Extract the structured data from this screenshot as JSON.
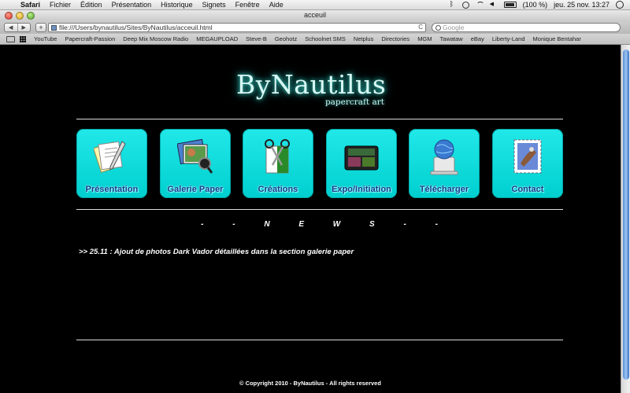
{
  "menubar": {
    "apple": "",
    "app_name": "Safari",
    "menus": [
      "Fichier",
      "Édition",
      "Présentation",
      "Historique",
      "Signets",
      "Fenêtre",
      "Aide"
    ],
    "battery": "(100 %)",
    "datetime": "jeu. 25 nov.  13:27"
  },
  "window": {
    "title": "acceuil"
  },
  "toolbar": {
    "back": "◀",
    "forward": "▶",
    "add": "+",
    "url": "file:///Users/bynautilus/Sites/ByNautilus/acceuil.html",
    "reload": "C",
    "search_placeholder": "Google"
  },
  "bookmarks": [
    "YouTube",
    "Papercraft-Passion",
    "Deep Mix Moscow Radio",
    "MEGAUPLOAD",
    "Steve-B",
    "Geohotz",
    "Schoolnet SMS",
    "Netplus",
    "Directories",
    "MGM",
    "Tawataw",
    "eBay",
    "Liberty-Land",
    "Monique Bentahar"
  ],
  "site": {
    "brand": "ByNautilus",
    "tagline": "papercraft art",
    "nav": [
      {
        "label": "Présentation"
      },
      {
        "label": "Galerie Paper"
      },
      {
        "label": "Créations"
      },
      {
        "label": "Expo/Initiation"
      },
      {
        "label": "Télécharger"
      },
      {
        "label": "Contact"
      }
    ],
    "news_letters": [
      "-",
      "-",
      "N",
      "E",
      "W",
      "S",
      "-",
      "-"
    ],
    "news_item": ">> 25.11 : Ajout de photos Dark Vador détaillées dans la section galerie paper",
    "copyright": "© Copyright 2010 - ByNautilus - All rights reserved"
  },
  "colors": {
    "tile": "#00d2d2",
    "tile_label": "#1a3a8c",
    "page_bg": "#000000",
    "logo_glow": "#3fd9d0"
  }
}
